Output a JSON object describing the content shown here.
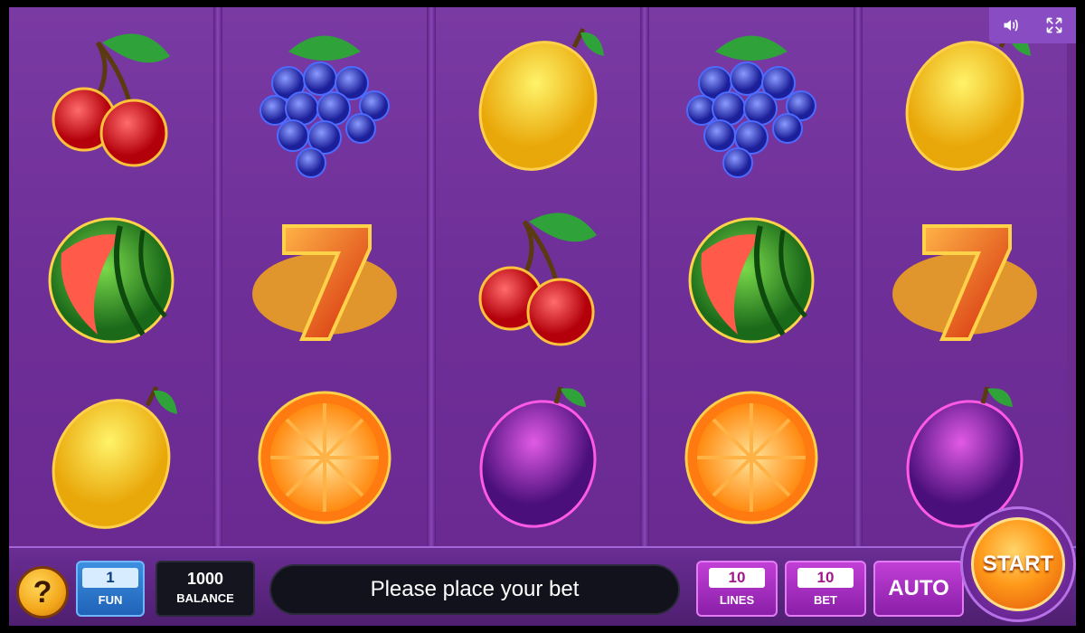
{
  "reels": [
    [
      "cherry",
      "watermelon",
      "lemon"
    ],
    [
      "grapes",
      "seven",
      "orange"
    ],
    [
      "lemon",
      "cherry",
      "plum"
    ],
    [
      "grapes",
      "watermelon",
      "orange"
    ],
    [
      "lemon",
      "seven",
      "plum"
    ]
  ],
  "top_controls": {
    "sound_icon": "speaker-icon",
    "fullscreen_icon": "fullscreen-icon"
  },
  "bottom_bar": {
    "help_label": "?",
    "fun": {
      "value": "1",
      "label": "FUN"
    },
    "balance": {
      "value": "1000",
      "label": "BALANCE"
    },
    "message": "Please place your bet",
    "lines": {
      "value": "10",
      "label": "LINES"
    },
    "bet": {
      "value": "10",
      "label": "BET"
    },
    "auto_label": "AUTO",
    "start_label": "START"
  },
  "colors": {
    "background": "#6a2c8e",
    "accent_orange": "#ff9a1a",
    "accent_magenta": "#c13fd6",
    "accent_blue": "#1f63b8"
  }
}
